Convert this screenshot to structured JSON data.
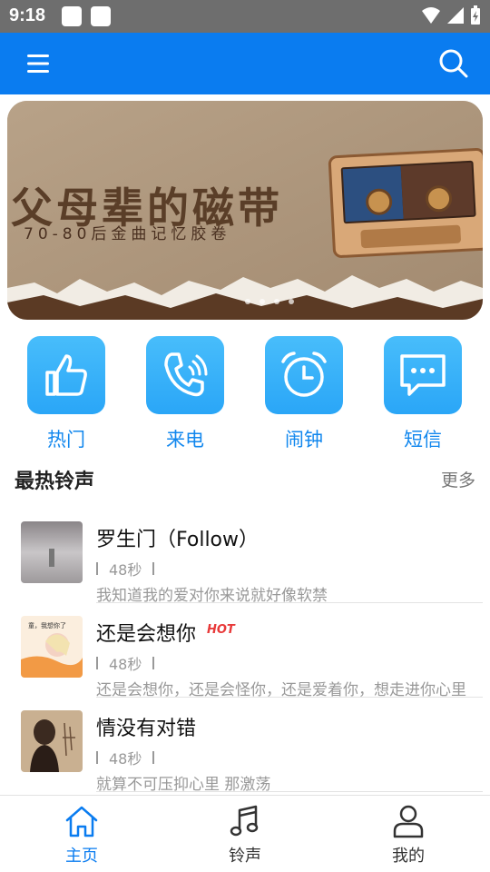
{
  "status_bar": {
    "time": "9:18"
  },
  "banner": {
    "title": "父母辈的磁带",
    "subtitle": "70-80后金曲记忆胶卷",
    "indicator_count": 4
  },
  "categories": [
    {
      "label": "热门",
      "icon": "thumbs-up-icon"
    },
    {
      "label": "来电",
      "icon": "phone-ringing-icon"
    },
    {
      "label": "闹钟",
      "icon": "alarm-clock-icon"
    },
    {
      "label": "短信",
      "icon": "message-icon"
    }
  ],
  "section": {
    "title": "最热铃声",
    "more": "更多"
  },
  "songs": [
    {
      "title": "罗生门（Follow）",
      "duration": "48秒",
      "desc": "我知道我的爱对你来说就好像软禁",
      "hot": ""
    },
    {
      "title": "还是会想你",
      "duration": "48秒",
      "desc": "还是会想你，还是会怪你，还是爱着你，想走进你心里",
      "hot": "HOT",
      "cover_caption": "童，我想你了"
    },
    {
      "title": "情没有对错",
      "duration": "48秒",
      "desc": "就算不可压抑心里 那激荡",
      "hot": ""
    }
  ],
  "nav": [
    {
      "label": "主页",
      "active": true
    },
    {
      "label": "铃声",
      "active": false
    },
    {
      "label": "我的",
      "active": false
    }
  ],
  "colors": {
    "primary": "#0a7cf0",
    "accent_text": "#1187ee",
    "hot": "#e83a3a"
  }
}
